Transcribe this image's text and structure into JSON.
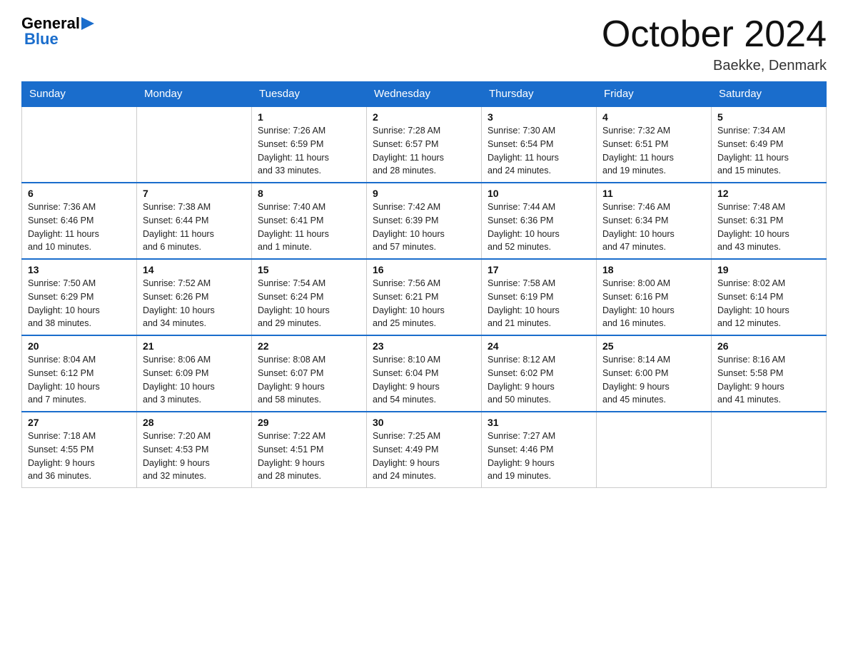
{
  "header": {
    "logo": {
      "general": "General",
      "arrow": "►",
      "blue": "Blue"
    },
    "title": "October 2024",
    "location": "Baekke, Denmark"
  },
  "weekdays": [
    "Sunday",
    "Monday",
    "Tuesday",
    "Wednesday",
    "Thursday",
    "Friday",
    "Saturday"
  ],
  "weeks": [
    [
      {
        "day": "",
        "info": ""
      },
      {
        "day": "",
        "info": ""
      },
      {
        "day": "1",
        "info": "Sunrise: 7:26 AM\nSunset: 6:59 PM\nDaylight: 11 hours\nand 33 minutes."
      },
      {
        "day": "2",
        "info": "Sunrise: 7:28 AM\nSunset: 6:57 PM\nDaylight: 11 hours\nand 28 minutes."
      },
      {
        "day": "3",
        "info": "Sunrise: 7:30 AM\nSunset: 6:54 PM\nDaylight: 11 hours\nand 24 minutes."
      },
      {
        "day": "4",
        "info": "Sunrise: 7:32 AM\nSunset: 6:51 PM\nDaylight: 11 hours\nand 19 minutes."
      },
      {
        "day": "5",
        "info": "Sunrise: 7:34 AM\nSunset: 6:49 PM\nDaylight: 11 hours\nand 15 minutes."
      }
    ],
    [
      {
        "day": "6",
        "info": "Sunrise: 7:36 AM\nSunset: 6:46 PM\nDaylight: 11 hours\nand 10 minutes."
      },
      {
        "day": "7",
        "info": "Sunrise: 7:38 AM\nSunset: 6:44 PM\nDaylight: 11 hours\nand 6 minutes."
      },
      {
        "day": "8",
        "info": "Sunrise: 7:40 AM\nSunset: 6:41 PM\nDaylight: 11 hours\nand 1 minute."
      },
      {
        "day": "9",
        "info": "Sunrise: 7:42 AM\nSunset: 6:39 PM\nDaylight: 10 hours\nand 57 minutes."
      },
      {
        "day": "10",
        "info": "Sunrise: 7:44 AM\nSunset: 6:36 PM\nDaylight: 10 hours\nand 52 minutes."
      },
      {
        "day": "11",
        "info": "Sunrise: 7:46 AM\nSunset: 6:34 PM\nDaylight: 10 hours\nand 47 minutes."
      },
      {
        "day": "12",
        "info": "Sunrise: 7:48 AM\nSunset: 6:31 PM\nDaylight: 10 hours\nand 43 minutes."
      }
    ],
    [
      {
        "day": "13",
        "info": "Sunrise: 7:50 AM\nSunset: 6:29 PM\nDaylight: 10 hours\nand 38 minutes."
      },
      {
        "day": "14",
        "info": "Sunrise: 7:52 AM\nSunset: 6:26 PM\nDaylight: 10 hours\nand 34 minutes."
      },
      {
        "day": "15",
        "info": "Sunrise: 7:54 AM\nSunset: 6:24 PM\nDaylight: 10 hours\nand 29 minutes."
      },
      {
        "day": "16",
        "info": "Sunrise: 7:56 AM\nSunset: 6:21 PM\nDaylight: 10 hours\nand 25 minutes."
      },
      {
        "day": "17",
        "info": "Sunrise: 7:58 AM\nSunset: 6:19 PM\nDaylight: 10 hours\nand 21 minutes."
      },
      {
        "day": "18",
        "info": "Sunrise: 8:00 AM\nSunset: 6:16 PM\nDaylight: 10 hours\nand 16 minutes."
      },
      {
        "day": "19",
        "info": "Sunrise: 8:02 AM\nSunset: 6:14 PM\nDaylight: 10 hours\nand 12 minutes."
      }
    ],
    [
      {
        "day": "20",
        "info": "Sunrise: 8:04 AM\nSunset: 6:12 PM\nDaylight: 10 hours\nand 7 minutes."
      },
      {
        "day": "21",
        "info": "Sunrise: 8:06 AM\nSunset: 6:09 PM\nDaylight: 10 hours\nand 3 minutes."
      },
      {
        "day": "22",
        "info": "Sunrise: 8:08 AM\nSunset: 6:07 PM\nDaylight: 9 hours\nand 58 minutes."
      },
      {
        "day": "23",
        "info": "Sunrise: 8:10 AM\nSunset: 6:04 PM\nDaylight: 9 hours\nand 54 minutes."
      },
      {
        "day": "24",
        "info": "Sunrise: 8:12 AM\nSunset: 6:02 PM\nDaylight: 9 hours\nand 50 minutes."
      },
      {
        "day": "25",
        "info": "Sunrise: 8:14 AM\nSunset: 6:00 PM\nDaylight: 9 hours\nand 45 minutes."
      },
      {
        "day": "26",
        "info": "Sunrise: 8:16 AM\nSunset: 5:58 PM\nDaylight: 9 hours\nand 41 minutes."
      }
    ],
    [
      {
        "day": "27",
        "info": "Sunrise: 7:18 AM\nSunset: 4:55 PM\nDaylight: 9 hours\nand 36 minutes."
      },
      {
        "day": "28",
        "info": "Sunrise: 7:20 AM\nSunset: 4:53 PM\nDaylight: 9 hours\nand 32 minutes."
      },
      {
        "day": "29",
        "info": "Sunrise: 7:22 AM\nSunset: 4:51 PM\nDaylight: 9 hours\nand 28 minutes."
      },
      {
        "day": "30",
        "info": "Sunrise: 7:25 AM\nSunset: 4:49 PM\nDaylight: 9 hours\nand 24 minutes."
      },
      {
        "day": "31",
        "info": "Sunrise: 7:27 AM\nSunset: 4:46 PM\nDaylight: 9 hours\nand 19 minutes."
      },
      {
        "day": "",
        "info": ""
      },
      {
        "day": "",
        "info": ""
      }
    ]
  ]
}
